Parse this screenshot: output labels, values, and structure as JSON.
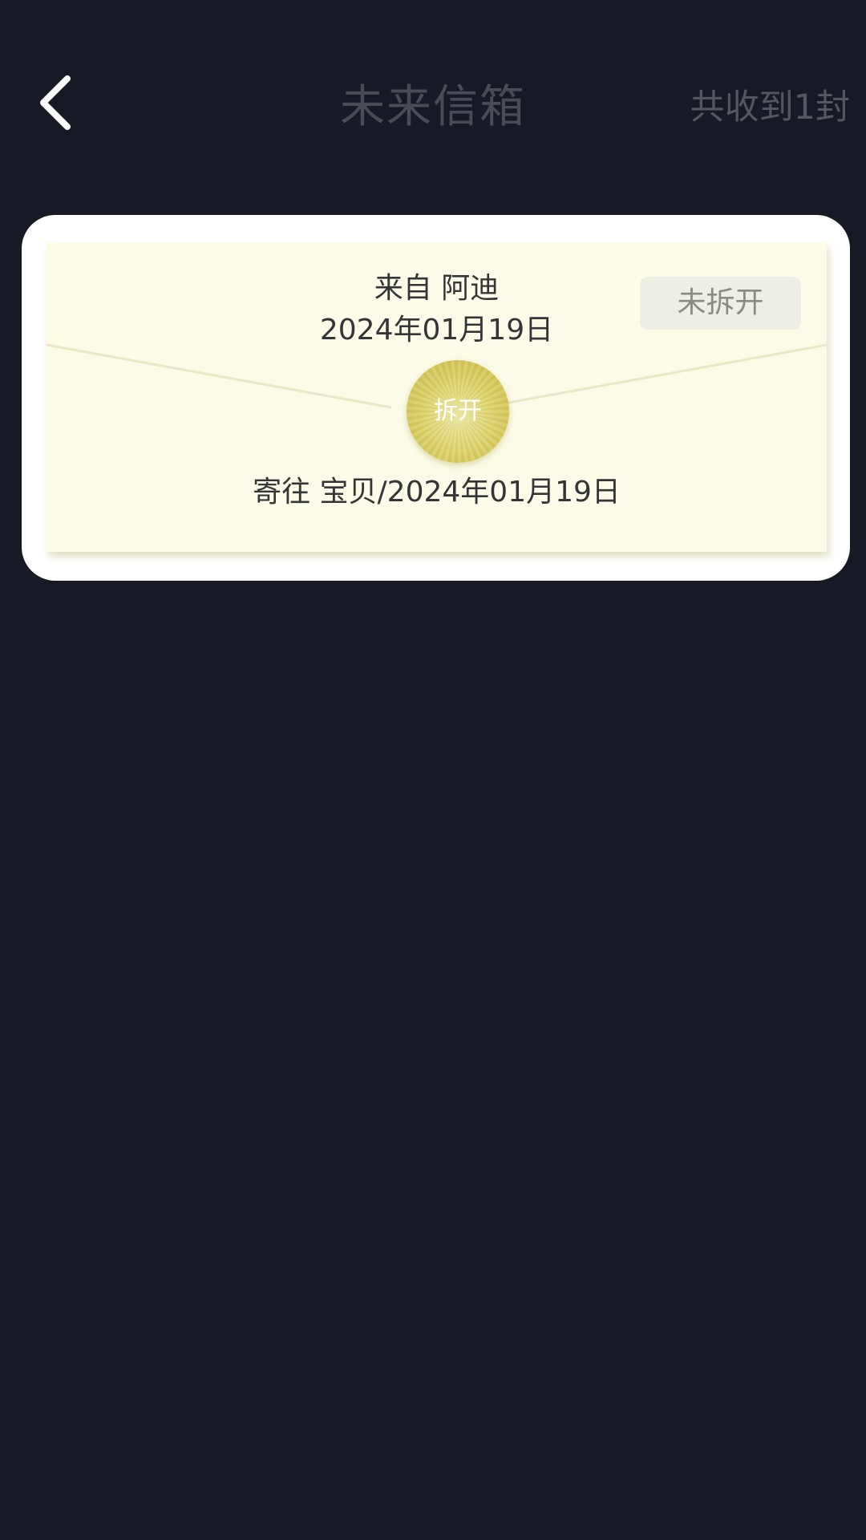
{
  "header": {
    "back_icon": "chevron-left-icon",
    "title": "未来信箱",
    "received_count": "共收到1封"
  },
  "letters": [
    {
      "sender": "来自 阿迪",
      "sent_date": "2024年01月19日",
      "status": "未拆开",
      "open_label": "拆开",
      "recipient": "寄往 宝贝/2024年01月19日"
    }
  ],
  "colors": {
    "background": "#171a24",
    "card": "#ffffff",
    "envelope": "#fcfbe8",
    "seal": "#d6cc60",
    "text": "#353535",
    "muted_title": "#4a4c55"
  }
}
